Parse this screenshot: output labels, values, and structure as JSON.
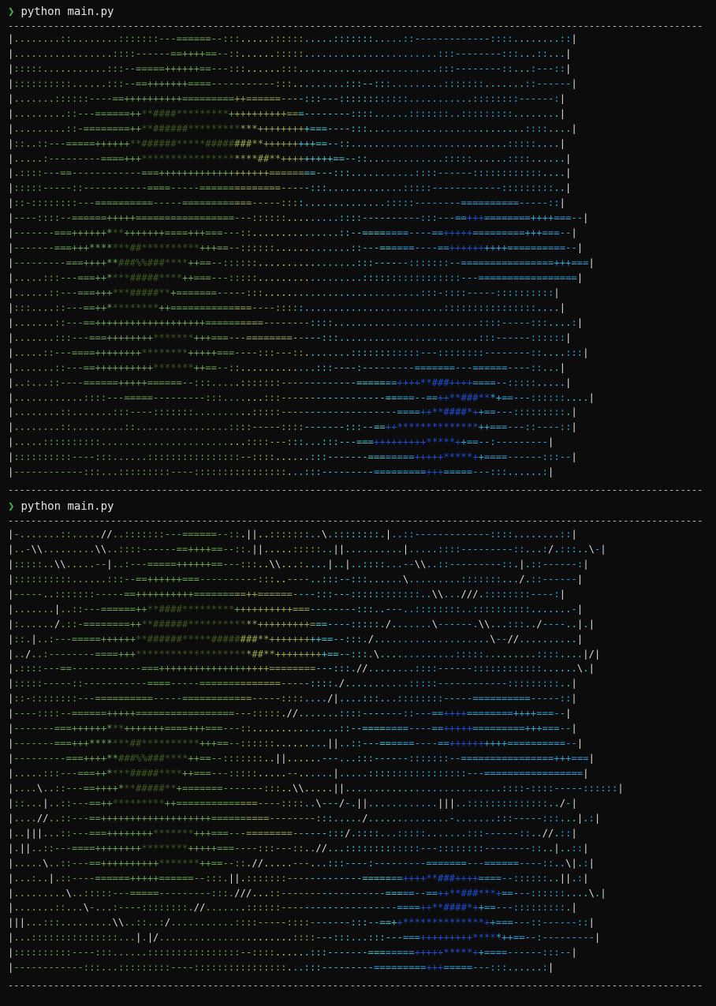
{
  "terminal": {
    "prompt_symbol": "❯",
    "blocks": [
      {
        "command": "python main.py",
        "rule_top": "----------------------------------------------------------------------------------------------------------------------------------------------------------------------------------------------",
        "rule_bottom": "----------------------------------------------------------------------------------------------------------------------------------------------------------------------------------------------",
        "rows": [
          "|........::........:::::::---======--:::.....::::::.....:::::::.....::-------------::::........::|",
          "|.................::::------==++++==--::......:::::.......................:::--------:::...::...|",
          "|:::::...........:::--=====++++++==---:::......:::........................:::--------::...:---::|",
          "|::::::::::......:::--==+++++++====-----------:::.........:::--:::.........:::::::.......::------|",
          "|.......::::::----==++++++++++=========++======----:::---::::::::::::...........::::::::------:|",
          "|.........::---======++**####*********++++++++++===--------::::......:::::::..:::::::::........|",
          "|.........::-========++**######************+++++++++===----:::...........................::::....|",
          "|::..::---=====++++++**######*****########**+++++++++==--::...........................:::::....|",
          "|.....:---------====+++********************##**+++++++++==--::.............:::::......::::......|",
          "|.::::---==------------===+++++++++++++++++++========---:::...........::::------::::::::::::....|",
          "|:::::-----::-----------====-----==============-----:::.............:::::------------:::::::::..|",
          "|::-::::::::---==========-----============-----::::..............:::::--------==========-----::|",
          "|----::::--======+++++=================---::::::.........::::----------:::---==+++========++++===--|",
          "|-------===++++++***+++++++====+++===---::...............::--========----==+++++=========+++===--|",
          "|-------===+++*******##**********+++==--::::::.............::---======----==++++++++++==========--|",
          "|---------===++++**###%%###****++==--::::::.................:::------:::::::--================+++===|",
          "|.....:::---===++****#####****++===---:::::..................:::::::::::::::::---=================|",
          "|......::---===+++***#####**+=======-----:::...........................:::-::::-----::::::::::|",
          "|:::....::---==++*********++==============----:::::........................::::::::::::::::....|",
          "|.......::---==+++++++++++++++++++==========--------::::.........................::::-----:::....:|",
          "|.......:::---===++++++++*******+++===---========-----:::........................:::------::::::|",
          "|.....::---====++++++++********+++++===----:::---::........::::::::::::---::::::::--------::....:::|",
          "|.......::---==++++++++++*******++==--::.............:::----:---------=======---======----::...|",
          "|..:...::----======+++++======--:::.....:::::::-------------=======++++**###++++====--:::::.....|",
          "|............::::---=====---------:::.......:::------------------=====--==++**###***+==---::::::....|",
          "|........::.......:::----:::::::..........:::::--------------------====++**####*++==---:::::::::.|",
          "|........::.........::................::::-----::::-------:::--==++**************++===---::----::|",
          "|.....::::::::::.........................::::---:::...:::---===+++++++++*****++==--:---------|",
          "|::::::::::----:::......::::::::::::::::--::::......:::-------========+++++*****++====------:::--|",
          "|------------:::...:::::::::----::::::::::::::::...:::---------=========+++=====---:::......:|"
        ]
      },
      {
        "command": "python main.py",
        "rule_top": "----------------------------------------------------------------------------------------------------------------------------------------------------------------------------------------------",
        "rule_bottom": "----------------------------------------------------------------------------------------------------------------------------------------------------------------------------------------------",
        "rows": [
          "|-.......::.....//..:::::::---======--::.||..:::::::..\\.::::::::.|..::-------------::::........::|",
          "|..-\\\\.........\\\\..::::------==++++==--::.||.....:::::..||..........|.....::::---------::...:/.:::..\\-|",
          "|:::::..\\\\.....--|..:---=====++++++==---:::..\\\\...:....|..|..::::...--\\\\..::---------::.|.::------:|",
          "|::::::::::......:::--==++++++===----------:::..----..:::--:::......\\.........:::::::.../.::------|",
          "|-----..:::::::-----==++++++++++=========++======----:::---::::::::::::..\\\\...///.::::::::----:|",
          "|.......|..::---======++**####*********++++++++++===--------:::..---..::::::::..::::::::::.......-|",
          "|:....../.::-========++**######************+++++++++===----:::::./.......\\------.\\\\...:::../----..|.|",
          "|::.|..:---=====++++++**######*****########**+++++++++==--:::./....................\\--//..........|",
          "|../..:--------====+++********************##**+++++++++==--:::.\\.............:::::.........::::....|/|",
          "|.::::---==------------===+++++++++++++++++++========---:::.//........::::------::::::::::::......\\.|",
          "|:::::-----::-----------====-----==============-----::::./...........:::::------------:::::::::..|",
          "|::-::::::::---==========-----============-----::::..../|....:::...::::::::-----==========-----::|",
          "|----::::--======+++++=================---:::::.//.......::::-------::---==++++========++++===--|",
          "|-------===++++++***+++++++====+++===---::...............::--========----==+++++=========+++===--|",
          "|-------===+++*******##**********+++==--::::::.........||..::---======----==++++++++++==========--|",
          "|---------===++++**###%%###****++==--:::::::..||......---...:::------:::::::--================+++===|",
          "|.....:::---===++****#####****++===---:::::.....--......|.....:::::::::::::::::---=================|",
          "|....\\..::---==++++***#####**+=======-------:::..\\\\.....||...........................::::-::::-----::::::|",
          "|::...|..::---==++*********++==============----::::..\\---/-.||............|||..::::::::::::::../-|",
          "|....//..::---==+++++++++++++++++++==========--------:::...../..............-.......:::-----:::...|.:|",
          "|..|||...::---===++++++++*******+++===---========------:::/.::::...:::::.......:::------::..//.::|",
          "|.||..::---====++++++++********+++++===----:::---::..//...:::::::::::::---::::::::--------::..|..::|",
          "|.....\\..::---==++++++++++*******++==--::.//.....---...:::----:---------=======---======----::..\\|.:|",
          "|...:..|.::----======+++++======--:::.||.:::::::-------------=======++++**###++++====--::::::..||.:|",
          "|.........\\..:::::---=====---------:::.///...::------------------=====--==++**###***+==---::::::....\\.|",
          "|.......::...\\-...:----::::::::.//.......::::::--------------------====++**####*++==---:::::::::.|",
          "|||...:::.........\\\\..::..:/...........::::-----::::-------:::--==++**************++===---::------::|",
          "|...:::::::::::::::...|.|/.......................::::---:::...:::---===+++++++++*****++==--:---------|",
          "|::::::::::----:::......::::::::::::::::--::::......:::-------========+++++*****++====------:::--|",
          "|------------:::...:::::::::----::::::::::::::::...:::---------=========+++=====---:::......:|"
        ]
      }
    ],
    "palette": {
      "background": "#0c0c0c",
      "prompt_chevron": "#3fb950",
      "text": "#e6e6e6",
      "rule": "#bdbdbd",
      "left_dark_green": "#3f5a1d",
      "left_green": "#6aa84f",
      "olive": "#9aa84a",
      "yellow_green": "#c7c75a",
      "cyan": "#3ec7d4",
      "sky": "#2aa8e0",
      "blue": "#1a73e8",
      "deep_blue": "#1b4fd6"
    }
  }
}
